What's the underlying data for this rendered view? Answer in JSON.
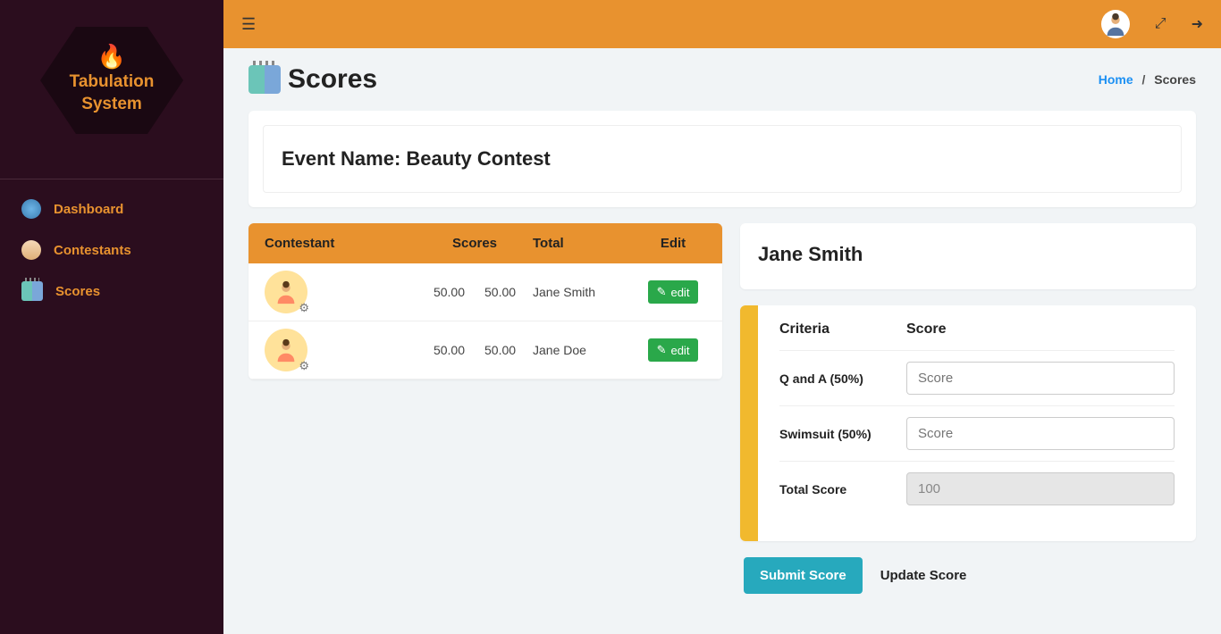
{
  "logo": {
    "line1": "Tabulation",
    "line2": "System"
  },
  "sidebar": {
    "items": [
      {
        "label": "Dashboard"
      },
      {
        "label": "Contestants"
      },
      {
        "label": "Scores"
      }
    ]
  },
  "breadcrumb": {
    "home": "Home",
    "current": "Scores"
  },
  "page": {
    "title": "Scores"
  },
  "event": {
    "prefix": "Event Name: ",
    "name": "Beauty Contest"
  },
  "table": {
    "headers": {
      "contestant": "Contestant",
      "scores": "Scores",
      "total": "Total",
      "edit": "Edit"
    },
    "rows": [
      {
        "score1": "50.00",
        "score2": "50.00",
        "total_name": "Jane Smith",
        "edit_label": "edit"
      },
      {
        "score1": "50.00",
        "score2": "50.00",
        "total_name": "Jane Doe",
        "edit_label": "edit"
      }
    ]
  },
  "panel": {
    "name": "Jane Smith",
    "headers": {
      "criteria": "Criteria",
      "score": "Score"
    },
    "criteria": [
      {
        "label": "Q and A (50%)",
        "placeholder": "Score"
      },
      {
        "label": "Swimsuit (50%)",
        "placeholder": "Score"
      }
    ],
    "total_label": "Total Score",
    "total_value": "100",
    "submit": "Submit Score",
    "update": "Update Score"
  }
}
